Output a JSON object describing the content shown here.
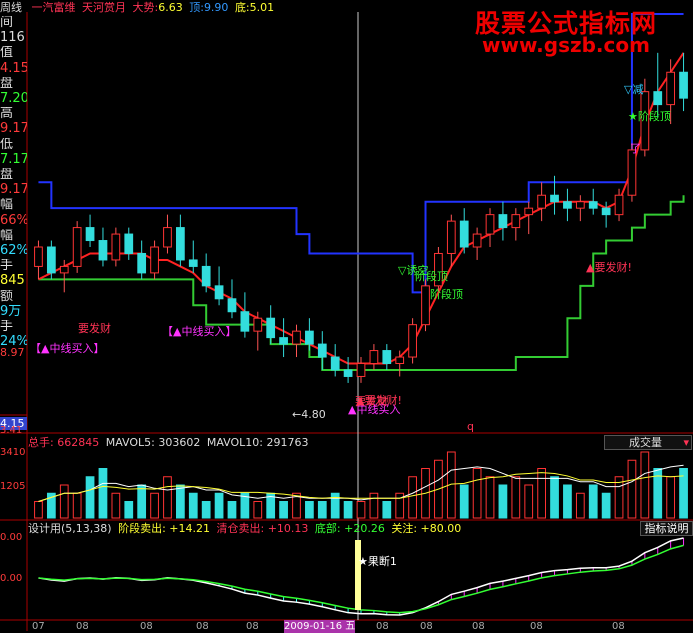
{
  "top_bar": {
    "period": "周线",
    "stock": "一汽富维",
    "title2": "天河赏月",
    "trend_label": "大势:",
    "trend_value": "6.63",
    "top_label": "顶:",
    "top_value": "9.90",
    "bottom_label": "底:",
    "bottom_value": "5.01"
  },
  "left_panel": [
    {
      "text": "间",
      "color": "#dddddd"
    },
    {
      "text": "116",
      "color": "#dddddd"
    },
    {
      "text": "值",
      "color": "#dddddd"
    },
    {
      "text": "4.15",
      "color": "#ff3b3b"
    },
    {
      "text": "盘",
      "color": "#dddddd"
    },
    {
      "text": "7.20",
      "color": "#33ff33"
    },
    {
      "text": "高",
      "color": "#dddddd"
    },
    {
      "text": "9.17",
      "color": "#ff3b3b"
    },
    {
      "text": "低",
      "color": "#dddddd"
    },
    {
      "text": "7.17",
      "color": "#33ff33"
    },
    {
      "text": "盘",
      "color": "#dddddd"
    },
    {
      "text": "9.17",
      "color": "#ff3b3b"
    },
    {
      "text": "幅",
      "color": "#dddddd"
    },
    {
      "text": "66%",
      "color": "#ff3b3b"
    },
    {
      "text": "幅",
      "color": "#dddddd"
    },
    {
      "text": "62%",
      "color": "#33ddff"
    },
    {
      "text": "手",
      "color": "#dddddd"
    },
    {
      "text": "845",
      "color": "#ffff33"
    },
    {
      "text": "额",
      "color": "#dddddd"
    },
    {
      "text": "9万",
      "color": "#33ddff"
    },
    {
      "text": "手",
      "color": "#dddddd"
    },
    {
      "text": "24%",
      "color": "#33ddff"
    }
  ],
  "price_axis": {
    "upper_label": "8.97",
    "lower_label": "4.15"
  },
  "watermark": {
    "line1": "股票公式指标网",
    "line2": "www.gszb.com"
  },
  "price_annotations": [
    {
      "text": "要发财",
      "color": "#ff3355"
    },
    {
      "text": "【▲中线买入】",
      "color": "#ff33ff"
    },
    {
      "text": "【▲中线买入】",
      "color": "#ff33ff"
    },
    {
      "text": "要发财",
      "color": "#ff3355"
    },
    {
      "text": "▲中线买入",
      "color": "#ff33ff"
    },
    {
      "text": "←4.80",
      "color": "#dddddd"
    },
    {
      "text": "▲要发财!",
      "color": "#ff3355"
    },
    {
      "text": "▽诱空",
      "color": "#33ff33"
    },
    {
      "text": "阶段顶",
      "color": "#33ff33"
    },
    {
      "text": "阶段顶",
      "color": "#33ff33"
    },
    {
      "text": "▲要发财!",
      "color": "#ff3355"
    },
    {
      "text": "▽减",
      "color": "#33ccff"
    },
    {
      "text": "★阶段顶",
      "color": "#33ff33"
    },
    {
      "text": "了",
      "color": "#ff33ff"
    },
    {
      "text": "q",
      "color": "#ff3355"
    }
  ],
  "volume_panel": {
    "title": "总手: 662845",
    "ma5": "MAVOL5: 303602",
    "ma10": "MAVOL10: 291763",
    "dropdown_label": "成交量",
    "axis_top": "3.41",
    "axis_mid1": "3410",
    "axis_mid2": "1205"
  },
  "indicator_panel": {
    "name": "设计用(5,13,38)",
    "stage_sell": "阶段卖出: +14.21",
    "clear_sell": "清仓卖出: +10.13",
    "bottom": "底部: +20.26",
    "attention": "关注: +80.00",
    "help_button": "指标说明",
    "axis_top": "0.00",
    "axis_mid": "0.00",
    "signal_label": "★果断1"
  },
  "date_axis": {
    "labels": [
      "07",
      "08",
      "08",
      "08",
      "08",
      "08",
      "08",
      "08",
      "08",
      "08",
      "08"
    ],
    "highlight": "2009-01-16 五"
  },
  "chart_data": {
    "type": "candlestick",
    "candles": [
      [
        6.6,
        7.0,
        6.4,
        6.9
      ],
      [
        6.9,
        7.0,
        6.4,
        6.5
      ],
      [
        6.5,
        6.7,
        6.2,
        6.6
      ],
      [
        6.6,
        7.3,
        6.5,
        7.2
      ],
      [
        7.2,
        7.4,
        6.9,
        7.0
      ],
      [
        7.0,
        7.2,
        6.6,
        6.7
      ],
      [
        6.7,
        7.2,
        6.6,
        7.1
      ],
      [
        7.1,
        7.2,
        6.7,
        6.8
      ],
      [
        6.8,
        7.0,
        6.4,
        6.5
      ],
      [
        6.5,
        7.0,
        6.4,
        6.9
      ],
      [
        6.9,
        7.4,
        6.8,
        7.2
      ],
      [
        7.2,
        7.4,
        6.6,
        6.7
      ],
      [
        6.7,
        7.0,
        6.5,
        6.6
      ],
      [
        6.6,
        6.8,
        6.2,
        6.3
      ],
      [
        6.3,
        6.6,
        6.0,
        6.1
      ],
      [
        6.1,
        6.4,
        5.8,
        5.9
      ],
      [
        5.9,
        6.2,
        5.5,
        5.6
      ],
      [
        5.6,
        5.9,
        5.3,
        5.8
      ],
      [
        5.8,
        6.0,
        5.4,
        5.5
      ],
      [
        5.5,
        5.8,
        5.2,
        5.4
      ],
      [
        5.4,
        5.7,
        5.2,
        5.6
      ],
      [
        5.6,
        5.8,
        5.3,
        5.4
      ],
      [
        5.4,
        5.6,
        5.0,
        5.2
      ],
      [
        5.2,
        5.4,
        4.9,
        5.0
      ],
      [
        5.0,
        5.2,
        4.8,
        4.9
      ],
      [
        4.9,
        5.2,
        4.8,
        5.1
      ],
      [
        5.1,
        5.4,
        5.0,
        5.3
      ],
      [
        5.3,
        5.4,
        5.0,
        5.1
      ],
      [
        5.1,
        5.3,
        4.9,
        5.2
      ],
      [
        5.2,
        5.8,
        5.1,
        5.7
      ],
      [
        5.7,
        6.4,
        5.6,
        6.3
      ],
      [
        6.3,
        6.9,
        6.2,
        6.8
      ],
      [
        6.8,
        7.4,
        6.6,
        7.3
      ],
      [
        7.3,
        7.5,
        6.8,
        6.9
      ],
      [
        6.9,
        7.2,
        6.7,
        7.1
      ],
      [
        7.1,
        7.5,
        6.9,
        7.4
      ],
      [
        7.4,
        7.6,
        7.0,
        7.2
      ],
      [
        7.2,
        7.5,
        7.0,
        7.4
      ],
      [
        7.4,
        7.6,
        7.1,
        7.5
      ],
      [
        7.5,
        7.9,
        7.3,
        7.7
      ],
      [
        7.7,
        8.0,
        7.4,
        7.6
      ],
      [
        7.6,
        7.8,
        7.3,
        7.5
      ],
      [
        7.5,
        7.7,
        7.3,
        7.6
      ],
      [
        7.6,
        7.8,
        7.4,
        7.5
      ],
      [
        7.5,
        7.6,
        7.2,
        7.4
      ],
      [
        7.4,
        7.8,
        7.3,
        7.7
      ],
      [
        7.7,
        8.5,
        7.6,
        8.4
      ],
      [
        8.4,
        9.5,
        8.3,
        9.3
      ],
      [
        9.3,
        9.9,
        8.9,
        9.1
      ],
      [
        9.1,
        9.8,
        8.8,
        9.6
      ],
      [
        9.6,
        9.9,
        9.0,
        9.2
      ]
    ],
    "blue_line": [
      7.9,
      7.5,
      7.5,
      7.5,
      7.5,
      7.5,
      7.5,
      7.5,
      7.5,
      7.5,
      7.5,
      7.5,
      7.5,
      7.5,
      7.5,
      7.5,
      7.5,
      7.5,
      7.5,
      7.5,
      7.1,
      6.8,
      6.8,
      6.8,
      6.8,
      6.8,
      6.8,
      6.8,
      6.8,
      6.2,
      7.6,
      7.6,
      7.6,
      7.6,
      7.6,
      7.6,
      7.6,
      7.6,
      7.9,
      7.9,
      7.9,
      7.9,
      7.9,
      7.9,
      7.9,
      7.9,
      10.5,
      10.5,
      10.5,
      10.5,
      10.5
    ],
    "red_line": [
      6.4,
      6.5,
      6.6,
      6.7,
      6.8,
      6.8,
      6.8,
      6.8,
      6.8,
      6.7,
      6.7,
      6.6,
      6.5,
      6.3,
      6.2,
      6.1,
      5.9,
      5.8,
      5.7,
      5.6,
      5.5,
      5.4,
      5.3,
      5.2,
      5.1,
      5.1,
      5.1,
      5.1,
      5.2,
      5.4,
      5.8,
      6.2,
      6.6,
      6.9,
      7.0,
      7.1,
      7.2,
      7.3,
      7.4,
      7.5,
      7.6,
      7.6,
      7.6,
      7.6,
      7.5,
      7.6,
      8.1,
      8.8,
      9.3,
      9.6,
      9.9
    ],
    "green_line": [
      6.4,
      6.4,
      6.4,
      6.4,
      6.4,
      6.4,
      6.4,
      6.4,
      6.4,
      6.4,
      6.4,
      6.4,
      6.0,
      5.7,
      5.7,
      5.7,
      5.7,
      5.7,
      5.4,
      5.4,
      5.4,
      5.2,
      5.0,
      5.0,
      5.0,
      5.0,
      5.0,
      5.0,
      5.0,
      5.0,
      5.0,
      5.0,
      5.0,
      5.0,
      5.0,
      5.0,
      5.0,
      5.2,
      5.2,
      5.2,
      5.2,
      5.8,
      6.3,
      6.8,
      7.0,
      7.0,
      7.2,
      7.4,
      7.4,
      7.6,
      7.7
    ],
    "volume": [
      2,
      3,
      4,
      3,
      5,
      6,
      3,
      2,
      4,
      3,
      5,
      4,
      3,
      2,
      3,
      2,
      3,
      2,
      3,
      2,
      3,
      2,
      2,
      3,
      2,
      2,
      3,
      2,
      3,
      5,
      6,
      7,
      8,
      4,
      6,
      5,
      4,
      5,
      4,
      6,
      5,
      4,
      3,
      4,
      3,
      5,
      7,
      8,
      6,
      5,
      6
    ],
    "ylim": [
      4.15,
      10.5
    ]
  }
}
